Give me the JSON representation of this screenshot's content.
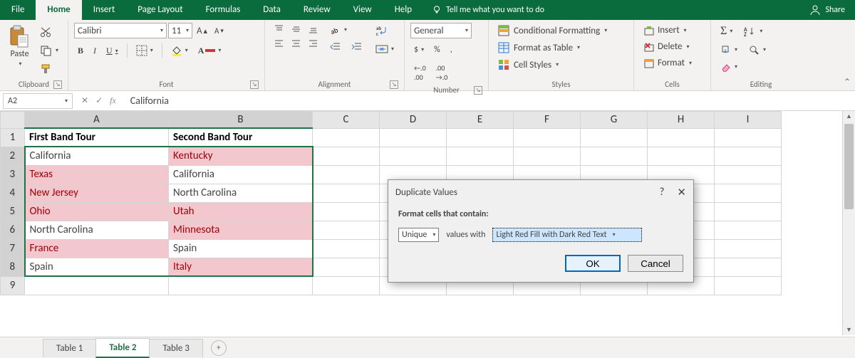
{
  "tabs": {
    "items": [
      "File",
      "Home",
      "Insert",
      "Page Layout",
      "Formulas",
      "Data",
      "Review",
      "View",
      "Help"
    ],
    "active": "Home",
    "tell_me": "Tell me what you want to do",
    "share": "Share"
  },
  "ribbon": {
    "clipboard": {
      "paste": "Paste",
      "label": "Clipboard"
    },
    "font": {
      "name": "Calibri",
      "size": "11",
      "bold": "B",
      "italic": "I",
      "underline": "U",
      "label": "Font"
    },
    "alignment": {
      "label": "Alignment"
    },
    "number": {
      "format": "General",
      "label": "Number",
      "dollar": "$",
      "percent": "%",
      "comma": ",",
      "inc": ".0",
      "dec": ".00"
    },
    "styles": {
      "cond": "Conditional Formatting",
      "table": "Format as Table",
      "cell": "Cell Styles",
      "label": "Styles"
    },
    "cells": {
      "insert": "Insert",
      "delete": "Delete",
      "format": "Format",
      "label": "Cells"
    },
    "editing": {
      "label": "Editing"
    }
  },
  "namebox": "A2",
  "formula": "California",
  "columns": [
    "A",
    "B",
    "C",
    "D",
    "E",
    "F",
    "G",
    "H",
    "I"
  ],
  "rows": [
    "1",
    "2",
    "3",
    "4",
    "5",
    "6",
    "7",
    "8",
    "9"
  ],
  "headers": {
    "A": "First Band Tour",
    "B": "Second Band Tour"
  },
  "dataA": [
    "California",
    "Texas",
    "New Jersey",
    "Ohio",
    "North Carolina",
    "France",
    "Spain"
  ],
  "dataB": [
    "Kentucky",
    "California",
    "North Carolina",
    "Utah",
    "Minnesota",
    "Spain",
    "Italy"
  ],
  "hlA": [
    false,
    true,
    true,
    true,
    false,
    true,
    false
  ],
  "hlB": [
    true,
    false,
    false,
    true,
    true,
    false,
    true
  ],
  "sheets": {
    "items": [
      "Table 1",
      "Table 2",
      "Table 3"
    ],
    "active": "Table 2"
  },
  "dialog": {
    "title": "Duplicate Values",
    "help": "?",
    "close": "✕",
    "prompt": "Format cells that contain:",
    "select1": "Unique",
    "mid": "values with",
    "select2": "Light Red Fill with Dark Red Text",
    "ok": "OK",
    "cancel": "Cancel"
  }
}
